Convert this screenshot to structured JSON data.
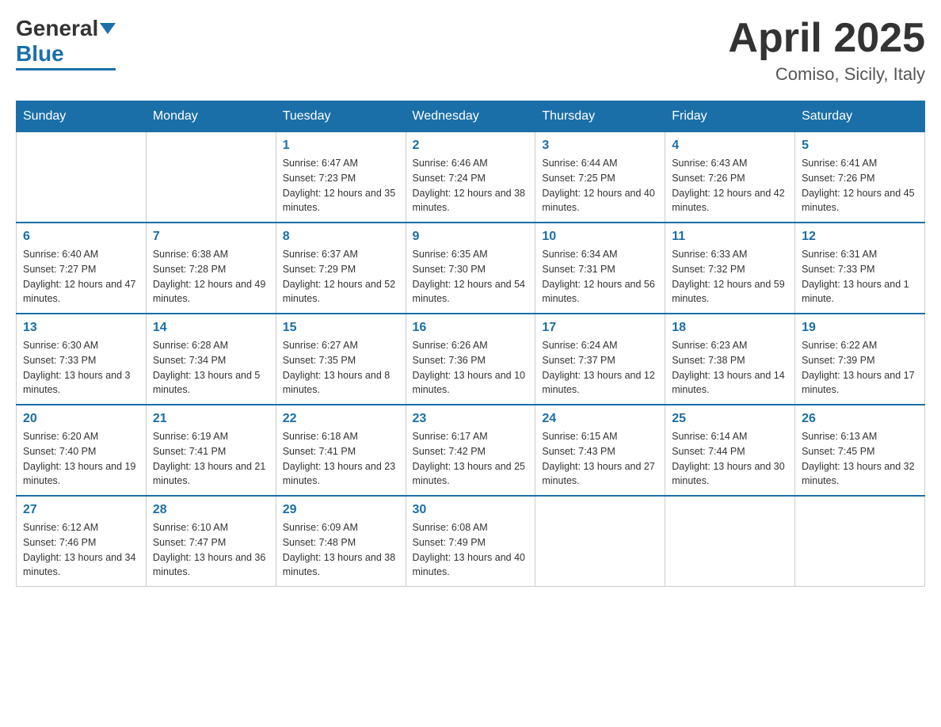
{
  "logo": {
    "general": "General",
    "blue": "Blue"
  },
  "title": {
    "month": "April 2025",
    "location": "Comiso, Sicily, Italy"
  },
  "weekdays": [
    "Sunday",
    "Monday",
    "Tuesday",
    "Wednesday",
    "Thursday",
    "Friday",
    "Saturday"
  ],
  "weeks": [
    [
      {
        "day": "",
        "sunrise": "",
        "sunset": "",
        "daylight": ""
      },
      {
        "day": "",
        "sunrise": "",
        "sunset": "",
        "daylight": ""
      },
      {
        "day": "1",
        "sunrise": "Sunrise: 6:47 AM",
        "sunset": "Sunset: 7:23 PM",
        "daylight": "Daylight: 12 hours and 35 minutes."
      },
      {
        "day": "2",
        "sunrise": "Sunrise: 6:46 AM",
        "sunset": "Sunset: 7:24 PM",
        "daylight": "Daylight: 12 hours and 38 minutes."
      },
      {
        "day": "3",
        "sunrise": "Sunrise: 6:44 AM",
        "sunset": "Sunset: 7:25 PM",
        "daylight": "Daylight: 12 hours and 40 minutes."
      },
      {
        "day": "4",
        "sunrise": "Sunrise: 6:43 AM",
        "sunset": "Sunset: 7:26 PM",
        "daylight": "Daylight: 12 hours and 42 minutes."
      },
      {
        "day": "5",
        "sunrise": "Sunrise: 6:41 AM",
        "sunset": "Sunset: 7:26 PM",
        "daylight": "Daylight: 12 hours and 45 minutes."
      }
    ],
    [
      {
        "day": "6",
        "sunrise": "Sunrise: 6:40 AM",
        "sunset": "Sunset: 7:27 PM",
        "daylight": "Daylight: 12 hours and 47 minutes."
      },
      {
        "day": "7",
        "sunrise": "Sunrise: 6:38 AM",
        "sunset": "Sunset: 7:28 PM",
        "daylight": "Daylight: 12 hours and 49 minutes."
      },
      {
        "day": "8",
        "sunrise": "Sunrise: 6:37 AM",
        "sunset": "Sunset: 7:29 PM",
        "daylight": "Daylight: 12 hours and 52 minutes."
      },
      {
        "day": "9",
        "sunrise": "Sunrise: 6:35 AM",
        "sunset": "Sunset: 7:30 PM",
        "daylight": "Daylight: 12 hours and 54 minutes."
      },
      {
        "day": "10",
        "sunrise": "Sunrise: 6:34 AM",
        "sunset": "Sunset: 7:31 PM",
        "daylight": "Daylight: 12 hours and 56 minutes."
      },
      {
        "day": "11",
        "sunrise": "Sunrise: 6:33 AM",
        "sunset": "Sunset: 7:32 PM",
        "daylight": "Daylight: 12 hours and 59 minutes."
      },
      {
        "day": "12",
        "sunrise": "Sunrise: 6:31 AM",
        "sunset": "Sunset: 7:33 PM",
        "daylight": "Daylight: 13 hours and 1 minute."
      }
    ],
    [
      {
        "day": "13",
        "sunrise": "Sunrise: 6:30 AM",
        "sunset": "Sunset: 7:33 PM",
        "daylight": "Daylight: 13 hours and 3 minutes."
      },
      {
        "day": "14",
        "sunrise": "Sunrise: 6:28 AM",
        "sunset": "Sunset: 7:34 PM",
        "daylight": "Daylight: 13 hours and 5 minutes."
      },
      {
        "day": "15",
        "sunrise": "Sunrise: 6:27 AM",
        "sunset": "Sunset: 7:35 PM",
        "daylight": "Daylight: 13 hours and 8 minutes."
      },
      {
        "day": "16",
        "sunrise": "Sunrise: 6:26 AM",
        "sunset": "Sunset: 7:36 PM",
        "daylight": "Daylight: 13 hours and 10 minutes."
      },
      {
        "day": "17",
        "sunrise": "Sunrise: 6:24 AM",
        "sunset": "Sunset: 7:37 PM",
        "daylight": "Daylight: 13 hours and 12 minutes."
      },
      {
        "day": "18",
        "sunrise": "Sunrise: 6:23 AM",
        "sunset": "Sunset: 7:38 PM",
        "daylight": "Daylight: 13 hours and 14 minutes."
      },
      {
        "day": "19",
        "sunrise": "Sunrise: 6:22 AM",
        "sunset": "Sunset: 7:39 PM",
        "daylight": "Daylight: 13 hours and 17 minutes."
      }
    ],
    [
      {
        "day": "20",
        "sunrise": "Sunrise: 6:20 AM",
        "sunset": "Sunset: 7:40 PM",
        "daylight": "Daylight: 13 hours and 19 minutes."
      },
      {
        "day": "21",
        "sunrise": "Sunrise: 6:19 AM",
        "sunset": "Sunset: 7:41 PM",
        "daylight": "Daylight: 13 hours and 21 minutes."
      },
      {
        "day": "22",
        "sunrise": "Sunrise: 6:18 AM",
        "sunset": "Sunset: 7:41 PM",
        "daylight": "Daylight: 13 hours and 23 minutes."
      },
      {
        "day": "23",
        "sunrise": "Sunrise: 6:17 AM",
        "sunset": "Sunset: 7:42 PM",
        "daylight": "Daylight: 13 hours and 25 minutes."
      },
      {
        "day": "24",
        "sunrise": "Sunrise: 6:15 AM",
        "sunset": "Sunset: 7:43 PM",
        "daylight": "Daylight: 13 hours and 27 minutes."
      },
      {
        "day": "25",
        "sunrise": "Sunrise: 6:14 AM",
        "sunset": "Sunset: 7:44 PM",
        "daylight": "Daylight: 13 hours and 30 minutes."
      },
      {
        "day": "26",
        "sunrise": "Sunrise: 6:13 AM",
        "sunset": "Sunset: 7:45 PM",
        "daylight": "Daylight: 13 hours and 32 minutes."
      }
    ],
    [
      {
        "day": "27",
        "sunrise": "Sunrise: 6:12 AM",
        "sunset": "Sunset: 7:46 PM",
        "daylight": "Daylight: 13 hours and 34 minutes."
      },
      {
        "day": "28",
        "sunrise": "Sunrise: 6:10 AM",
        "sunset": "Sunset: 7:47 PM",
        "daylight": "Daylight: 13 hours and 36 minutes."
      },
      {
        "day": "29",
        "sunrise": "Sunrise: 6:09 AM",
        "sunset": "Sunset: 7:48 PM",
        "daylight": "Daylight: 13 hours and 38 minutes."
      },
      {
        "day": "30",
        "sunrise": "Sunrise: 6:08 AM",
        "sunset": "Sunset: 7:49 PM",
        "daylight": "Daylight: 13 hours and 40 minutes."
      },
      {
        "day": "",
        "sunrise": "",
        "sunset": "",
        "daylight": ""
      },
      {
        "day": "",
        "sunrise": "",
        "sunset": "",
        "daylight": ""
      },
      {
        "day": "",
        "sunrise": "",
        "sunset": "",
        "daylight": ""
      }
    ]
  ]
}
